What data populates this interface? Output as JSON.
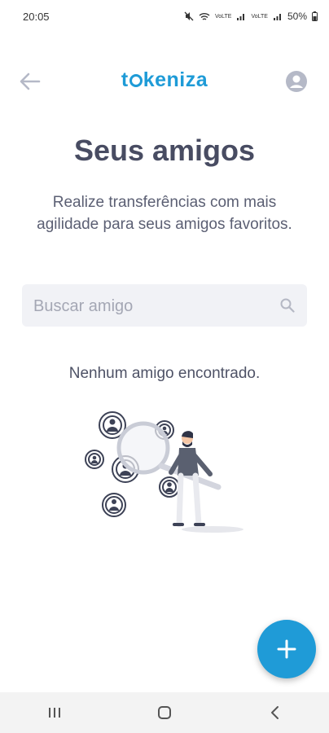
{
  "status": {
    "time": "20:05",
    "battery": "50%",
    "net1": "VoLTE",
    "net2": "VoLTE"
  },
  "header": {
    "logo_prefix": "t",
    "logo_suffix": "keniza",
    "back_icon": "arrow-left-icon",
    "profile_icon": "user-circle-icon"
  },
  "main": {
    "title": "Seus amigos",
    "subtitle": "Realize transferências com mais agilidade para seus amigos favoritos.",
    "search": {
      "placeholder": "Buscar amigo",
      "value": ""
    },
    "empty_message": "Nenhum amigo encontrado."
  },
  "fab": {
    "icon": "plus-icon"
  },
  "colors": {
    "accent": "#1e9bd7",
    "title": "#484c62",
    "search_bg": "#f1f2f6"
  },
  "nav": {
    "recent_icon": "recent-apps-icon",
    "home_icon": "home-icon",
    "back_icon": "back-icon"
  }
}
